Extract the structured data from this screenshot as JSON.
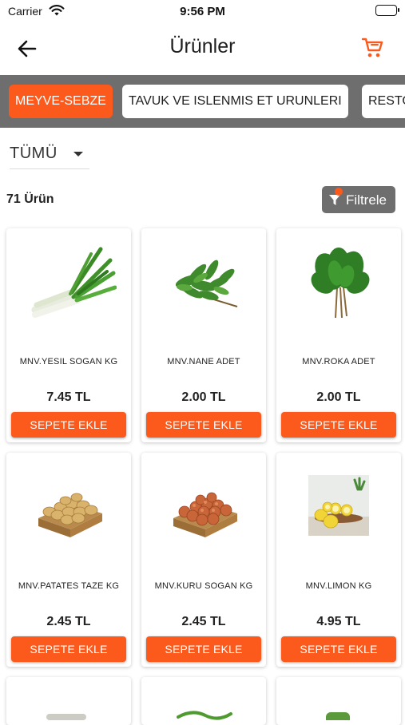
{
  "status_bar": {
    "carrier": "Carrier",
    "time": "9:56 PM"
  },
  "header": {
    "title": "Ürünler",
    "back_icon": "back-arrow-icon",
    "cart_icon": "cart-icon",
    "accent": "#fb5a1c"
  },
  "categories": [
    {
      "label": "MEYVE-SEBZE",
      "active": true
    },
    {
      "label": "TAVUK VE ISLENMIS ET URUNLERI",
      "active": false
    },
    {
      "label": "RESTO",
      "active": false
    }
  ],
  "sort": {
    "selected": "TÜMÜ"
  },
  "list": {
    "count_label": "71 Ürün",
    "filter_label": "Filtrele"
  },
  "products": [
    {
      "name": "MNV.YESIL SOGAN KG",
      "price": "7.45 TL",
      "button": "SEPETE EKLE",
      "image": "green-onion"
    },
    {
      "name": "MNV.NANE ADET",
      "price": "2.00 TL",
      "button": "SEPETE EKLE",
      "image": "mint"
    },
    {
      "name": "MNV.ROKA ADET",
      "price": "2.00 TL",
      "button": "SEPETE EKLE",
      "image": "arugula"
    },
    {
      "name": "MNV.PATATES TAZE KG",
      "price": "2.45 TL",
      "button": "SEPETE EKLE",
      "image": "potato-crate"
    },
    {
      "name": "MNV.KURU SOGAN KG",
      "price": "2.45 TL",
      "button": "SEPETE EKLE",
      "image": "onion-crate"
    },
    {
      "name": "MNV.LIMON KG",
      "price": "4.95 TL",
      "button": "SEPETE EKLE",
      "image": "lemons"
    }
  ]
}
